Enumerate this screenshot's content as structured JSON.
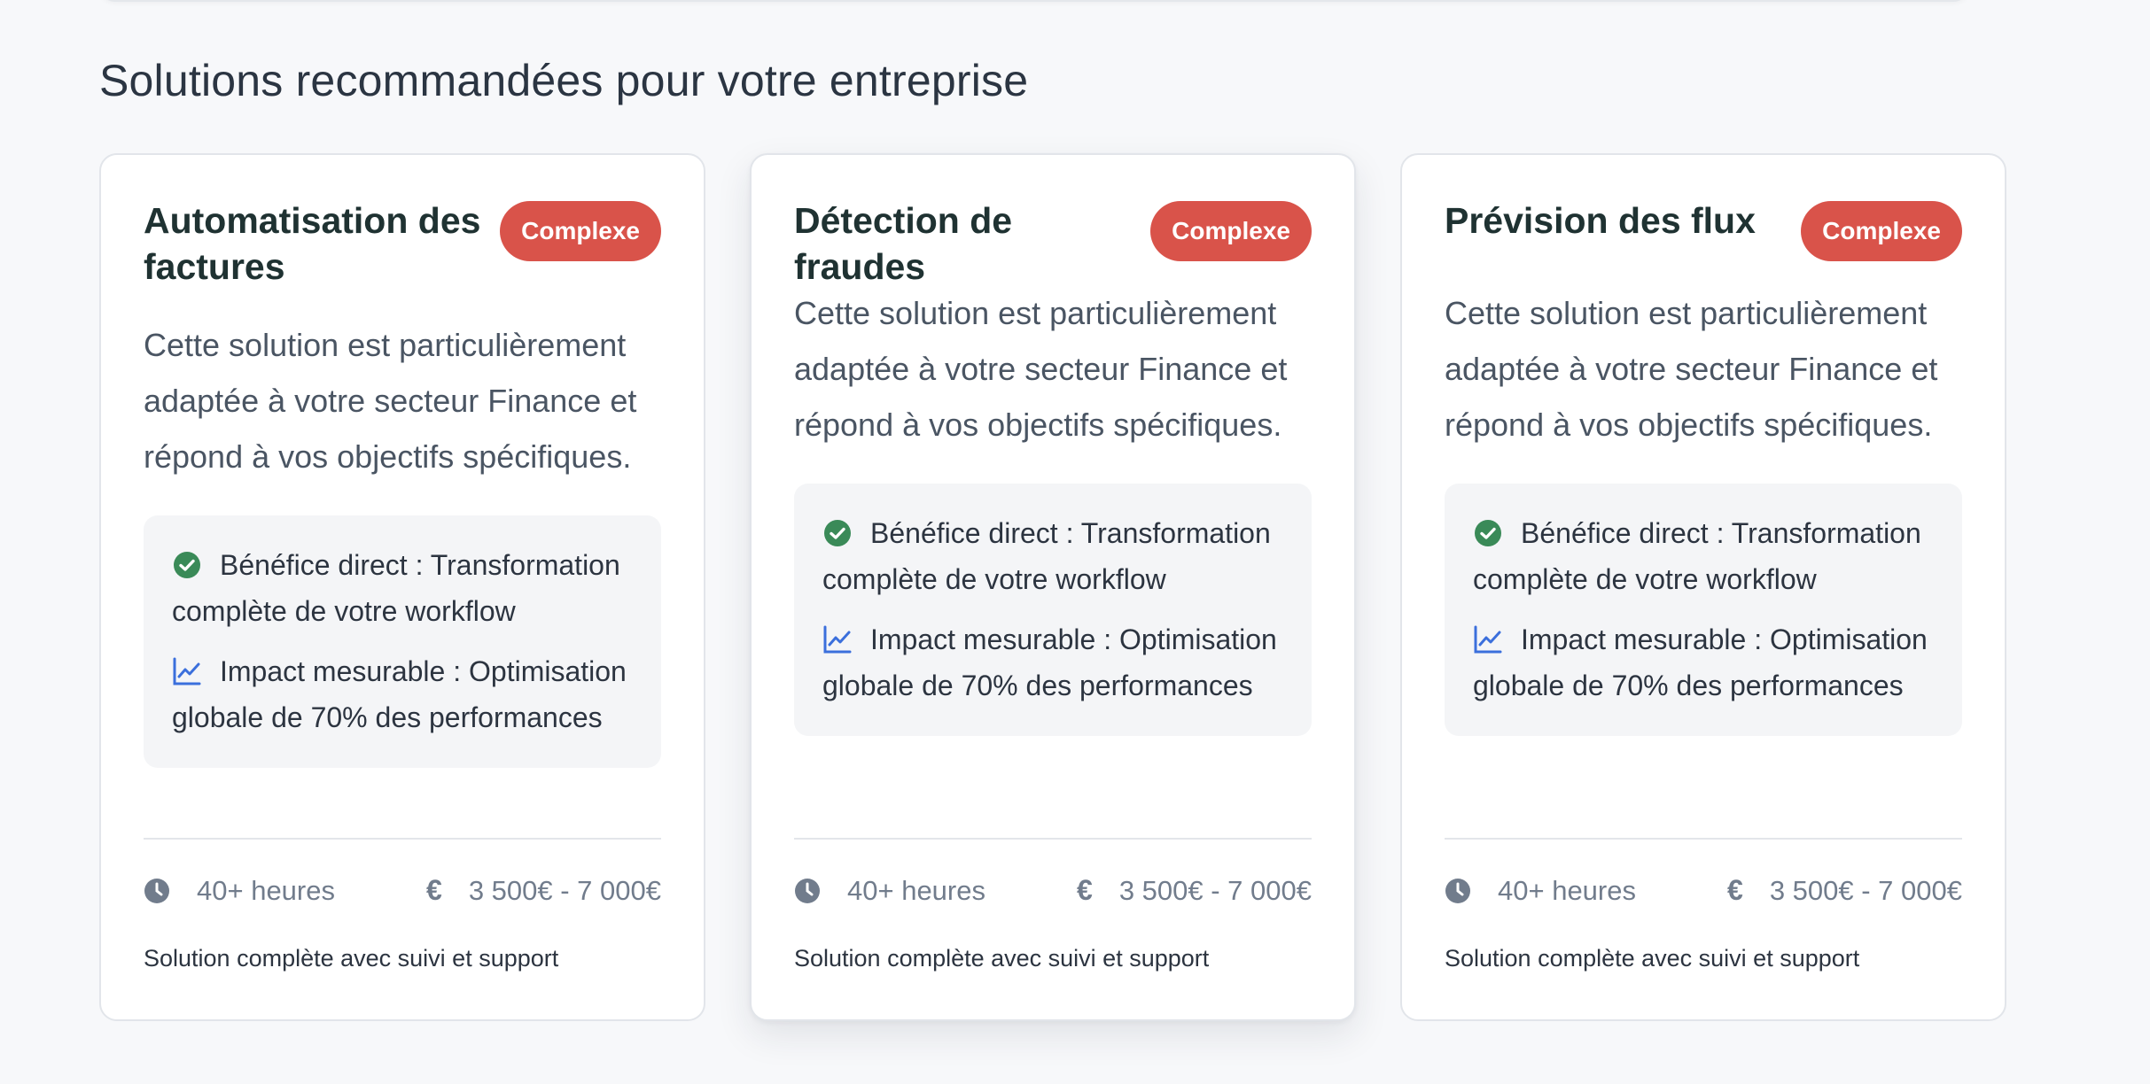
{
  "section": {
    "title": "Solutions recommandées pour votre entreprise"
  },
  "colors": {
    "badge": "#d9534a",
    "check": "#3a8a58",
    "chart": "#3b6fdc"
  },
  "cards": [
    {
      "title": "Automatisation des factures",
      "badge": "Complexe",
      "description": "Cette solution est particulièrement adaptée à votre secteur Finance et répond à vos objectifs spécifiques.",
      "benefit_direct": "Bénéfice direct : Transformation complète de votre workflow",
      "impact": "Impact mesurable : Optimisation globale de 70% des performances",
      "duration": "40+ heures",
      "price": "3 500€ - 7 000€",
      "footnote": "Solution complète avec suivi et support"
    },
    {
      "title": "Détection de fraudes",
      "badge": "Complexe",
      "description": "Cette solution est particulièrement adaptée à votre secteur Finance et répond à vos objectifs spécifiques.",
      "benefit_direct": "Bénéfice direct : Transformation complète de votre workflow",
      "impact": "Impact mesurable : Optimisation globale de 70% des performances",
      "duration": "40+ heures",
      "price": "3 500€ - 7 000€",
      "footnote": "Solution complète avec suivi et support"
    },
    {
      "title": "Prévision des flux",
      "badge": "Complexe",
      "description": "Cette solution est particulièrement adaptée à votre secteur Finance et répond à vos objectifs spécifiques.",
      "benefit_direct": "Bénéfice direct : Transformation complète de votre workflow",
      "impact": "Impact mesurable : Optimisation globale de 70% des performances",
      "duration": "40+ heures",
      "price": "3 500€ - 7 000€",
      "footnote": "Solution complète avec suivi et support"
    }
  ],
  "icons": {
    "check": "check-circle-icon",
    "chart": "chart-line-icon",
    "clock": "clock-icon",
    "euro": "euro-icon",
    "euro_glyph": "€"
  }
}
